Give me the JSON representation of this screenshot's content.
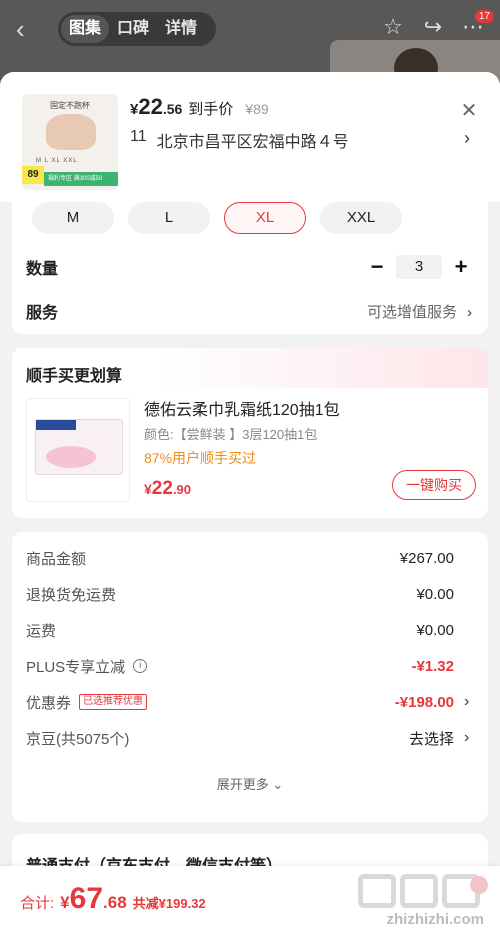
{
  "nav": {
    "tabs": [
      "图集",
      "口碑",
      "详情"
    ],
    "active_tab": 0,
    "badge_count": "17",
    "icons": [
      "back-icon",
      "star-icon",
      "share-icon",
      "more-icon"
    ]
  },
  "product": {
    "thumb_caption": "固定不跑杯",
    "thumb_sizes": "M L XL XXL",
    "thumb_price": "89",
    "thumb_promo": "福利专区 满300减50",
    "price_currency": "¥",
    "price_int": "22",
    "price_dec": ".56",
    "price_label": "到手价",
    "orig_price": "¥89",
    "address_num": "11",
    "address": "北京市昌平区宏福中路４号"
  },
  "sizes": {
    "options": [
      "M",
      "L",
      "XL",
      "XXL"
    ],
    "selected": "XL"
  },
  "quantity": {
    "label": "数量",
    "value": "3",
    "minus": "−",
    "plus": "+"
  },
  "service": {
    "label": "服务",
    "value": "可选增值服务"
  },
  "buy_more": {
    "title": "顺手买更划算",
    "name": "德佑云柔巾乳霜纸120抽1包",
    "spec": "颜色:【尝鲜装 】3层120抽1包",
    "stat": "87%用户顺手买过",
    "price_currency": "¥",
    "price_int": "22",
    "price_dec": ".90",
    "button": "一键购买"
  },
  "fees": {
    "rows": [
      {
        "label": "商品金额",
        "value": "¥267.00"
      },
      {
        "label": "退换货免运费",
        "value": "¥0.00"
      },
      {
        "label": "运费",
        "value": "¥0.00"
      },
      {
        "label": "PLUS专享立减",
        "value": "-¥1.32"
      },
      {
        "label": "优惠券",
        "value": "-¥198.00",
        "tag": "已选推荐优惠"
      },
      {
        "label": "京豆(共5075个)",
        "value": "去选择"
      }
    ],
    "expand": "展开更多 ⌄"
  },
  "payment": {
    "title": "普通支付（京东支付、微信支付等）"
  },
  "total": {
    "label": "合计:",
    "currency": "¥",
    "int": "67",
    "dec": ".68",
    "save": "共减¥199.32"
  },
  "watermark": {
    "text": "zhizhizhi.com"
  },
  "colors": {
    "accent": "#e4393c",
    "orange": "#f08a18"
  }
}
